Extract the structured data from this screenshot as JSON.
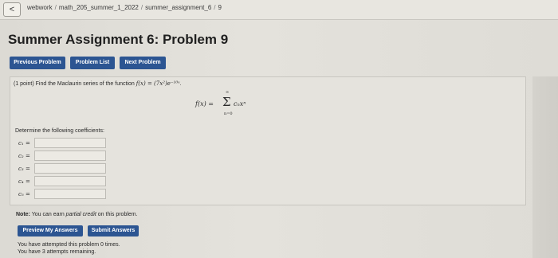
{
  "breadcrumb": {
    "back_glyph": "<",
    "parts": [
      "webwork",
      "math_205_summer_1_2022",
      "summer_assignment_6",
      "9"
    ],
    "separator": "/"
  },
  "page_title": "Summer Assignment 6: Problem 9",
  "nav": {
    "previous": "Previous Problem",
    "list": "Problem List",
    "next": "Next Problem"
  },
  "problem": {
    "points": "(1 point)",
    "prompt_text": "Find the Maclaurin series of the function",
    "function_expr": "f(x) = (7x²)e⁻¹⁰ˣ",
    "prompt_end": ".",
    "formula": {
      "lhs": "f(x) =",
      "sigma": "Σ",
      "upper": "∞",
      "lower": "n=0",
      "term": "cₙxⁿ"
    },
    "determine_label": "Determine the following coefficients:",
    "coefficients": [
      {
        "label": "c₁ =",
        "value": ""
      },
      {
        "label": "c₂ =",
        "value": ""
      },
      {
        "label": "c₃ =",
        "value": ""
      },
      {
        "label": "c₄ =",
        "value": ""
      },
      {
        "label": "c₅ =",
        "value": ""
      }
    ]
  },
  "note": {
    "prefix": "Note:",
    "text_a": "You can earn",
    "text_b": "partial credit",
    "text_c": "on this problem."
  },
  "actions": {
    "preview": "Preview My Answers",
    "submit": "Submit Answers"
  },
  "status": {
    "attempted": "You have attempted this problem 0 times.",
    "remaining": "You have 3 attempts remaining."
  }
}
